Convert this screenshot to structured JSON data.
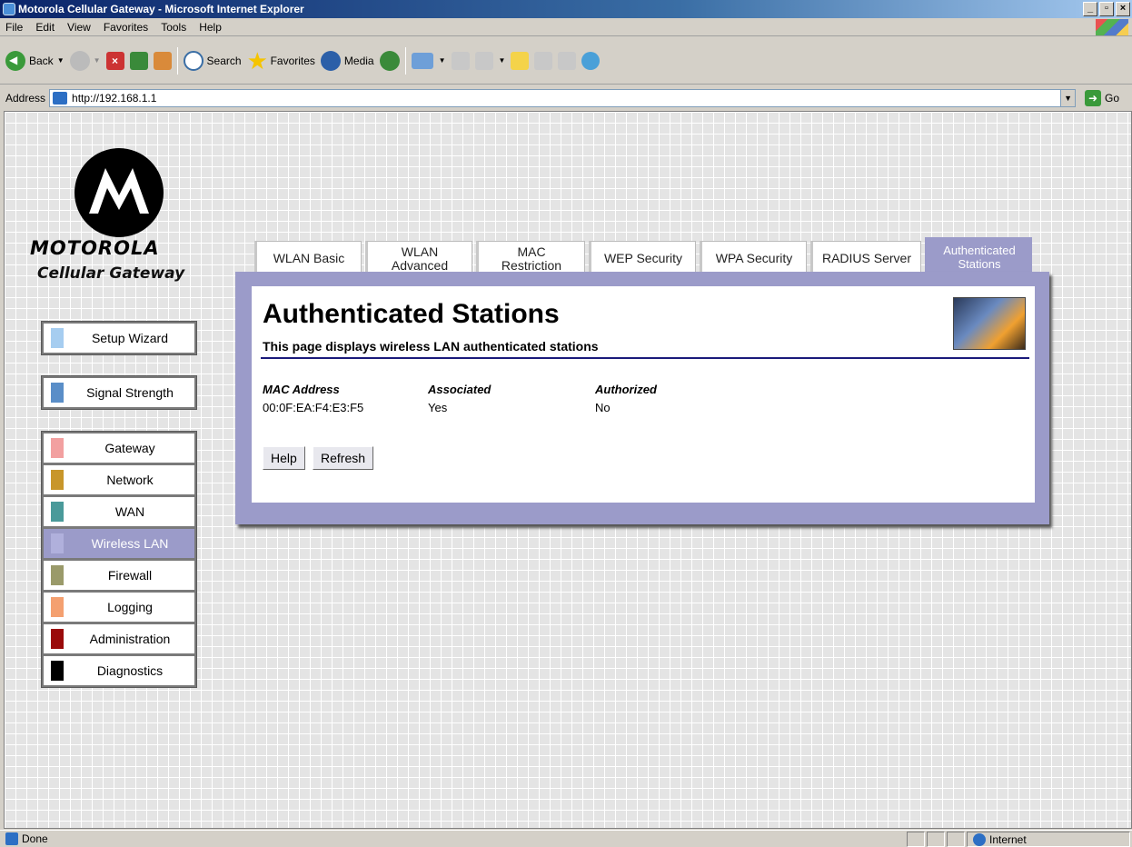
{
  "window": {
    "title": "Motorola Cellular Gateway - Microsoft Internet Explorer"
  },
  "menu": [
    "File",
    "Edit",
    "View",
    "Favorites",
    "Tools",
    "Help"
  ],
  "toolbar": {
    "back": "Back",
    "search": "Search",
    "favorites": "Favorites",
    "media": "Media"
  },
  "address": {
    "label": "Address",
    "url": "http://192.168.1.1",
    "go": "Go"
  },
  "brand": {
    "name": "MOTOROLA",
    "product": "Cellular Gateway"
  },
  "nav": [
    {
      "label": "Setup Wizard",
      "color": "#a6cdf0"
    },
    {
      "label": "Signal Strength",
      "color": "#5a8ec8"
    },
    {
      "label": "Gateway",
      "color": "#f2a0a0"
    },
    {
      "label": "Network",
      "color": "#c8962a"
    },
    {
      "label": "WAN",
      "color": "#4a9a9a"
    },
    {
      "label": "Wireless LAN",
      "color": "#b0b0dc",
      "active": true
    },
    {
      "label": "Firewall",
      "color": "#9a9a6a"
    },
    {
      "label": "Logging",
      "color": "#f4a070"
    },
    {
      "label": "Administration",
      "color": "#9a0a0a"
    },
    {
      "label": "Diagnostics",
      "color": "#000000"
    }
  ],
  "tabs": [
    {
      "line1": "WLAN Basic",
      "line2": ""
    },
    {
      "line1": "WLAN",
      "line2": "Advanced"
    },
    {
      "line1": "MAC Restriction",
      "line2": ""
    },
    {
      "line1": "WEP Security",
      "line2": ""
    },
    {
      "line1": "WPA Security",
      "line2": ""
    },
    {
      "line1": "RADIUS Server",
      "line2": ""
    },
    {
      "line1": "Authenticated",
      "line2": "Stations",
      "active": true
    }
  ],
  "page": {
    "title": "Authenticated Stations",
    "description": "This page displays wireless LAN authenticated stations"
  },
  "table": {
    "headers": [
      "MAC Address",
      "Associated",
      "Authorized"
    ],
    "rows": [
      [
        "00:0F:EA:F4:E3:F5",
        "Yes",
        "No"
      ]
    ]
  },
  "buttons": {
    "help": "Help",
    "refresh": "Refresh"
  },
  "status": {
    "text": "Done",
    "zone": "Internet"
  }
}
